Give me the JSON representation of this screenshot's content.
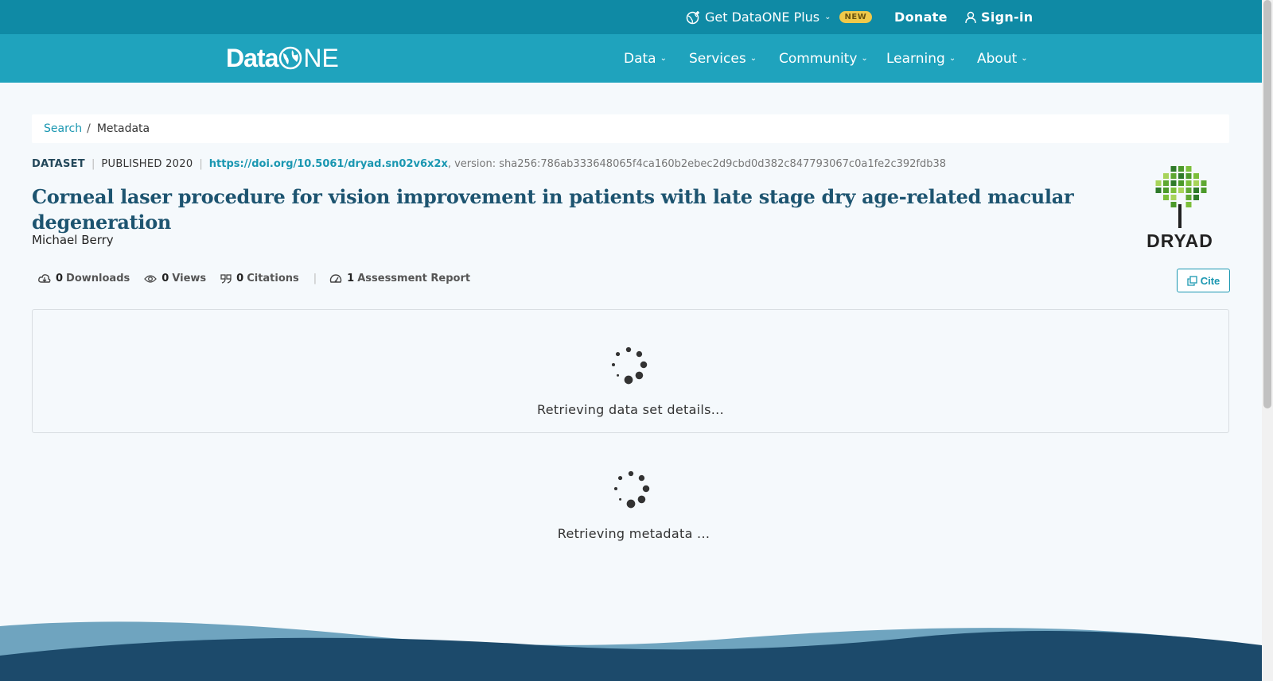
{
  "topbar": {
    "plus_label": "Get DataONE Plus",
    "new_badge": "NEW",
    "donate": "Donate",
    "signin": "Sign-in"
  },
  "nav": {
    "logo_data": "Data",
    "logo_one": "NE",
    "items": [
      {
        "label": "Data"
      },
      {
        "label": "Services"
      },
      {
        "label": "Community"
      },
      {
        "label": "Learning"
      },
      {
        "label": "About"
      }
    ]
  },
  "breadcrumb": {
    "search": "Search",
    "separator": "/",
    "current": "Metadata"
  },
  "dataset": {
    "type": "DATASET",
    "published": "PUBLISHED 2020",
    "doi": "https://doi.org/10.5061/dryad.sn02v6x2x",
    "version": ", version: sha256:786ab333648065f4ca160b2ebec2d9cbd0d382c847793067c0a1fe2c392fdb38",
    "title": "Corneal laser procedure for vision improvement in patients with late stage dry age-related macular degeneration",
    "author": "Michael Berry",
    "repository_logo": "DRYAD"
  },
  "metrics": {
    "downloads_count": "0",
    "downloads_label": "Downloads",
    "views_count": "0",
    "views_label": "Views",
    "citations_count": "0",
    "citations_label": "Citations",
    "assessment_count": "1",
    "assessment_label": "Assessment Report",
    "cite_label": "Cite"
  },
  "loading": {
    "details": "Retrieving data set details...",
    "metadata": "Retrieving metadata ..."
  },
  "colors": {
    "topbar": "#0f8aa5",
    "navbar": "#1fa3bd",
    "accent": "#1a97b1",
    "title": "#1d5470",
    "footer_dark": "#1c4a6b",
    "footer_light": "#6fa4bf"
  }
}
